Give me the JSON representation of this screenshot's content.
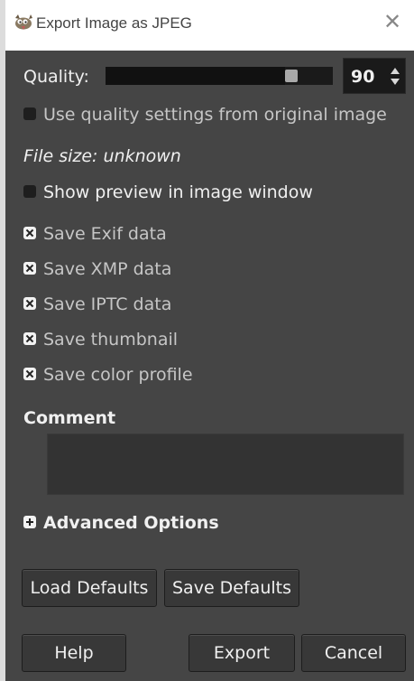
{
  "window": {
    "title": "Export Image as JPEG",
    "close_glyph": "✕"
  },
  "quality": {
    "label": "Quality:",
    "value": "90",
    "slider_fraction": 0.9
  },
  "options": {
    "use_original_quality": {
      "label": "Use quality settings from original image",
      "checked": false
    },
    "file_size": "File size: unknown",
    "show_preview": {
      "label": "Show preview in image window",
      "checked": false
    },
    "save_exif": {
      "label": "Save Exif data",
      "checked": true
    },
    "save_xmp": {
      "label": "Save XMP data",
      "checked": true
    },
    "save_iptc": {
      "label": "Save IPTC data",
      "checked": true
    },
    "save_thumbnail": {
      "label": "Save thumbnail",
      "checked": true
    },
    "save_color_profile": {
      "label": "Save color profile",
      "checked": true
    }
  },
  "comment": {
    "label": "Comment",
    "value": ""
  },
  "advanced": {
    "label": "Advanced Options"
  },
  "buttons": {
    "load_defaults": "Load Defaults",
    "save_defaults": "Save Defaults",
    "help": "Help",
    "export": "Export",
    "cancel": "Cancel"
  },
  "colors": {
    "dialog_bg": "#454545",
    "titlebar_bg": "#ffffff",
    "text": "#f0f0f0"
  }
}
